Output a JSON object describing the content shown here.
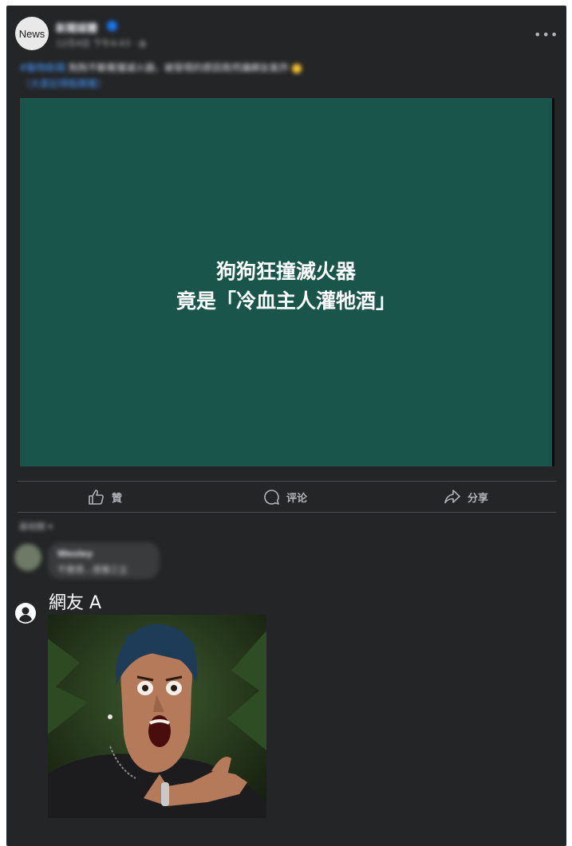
{
  "post": {
    "avatar_text": "News",
    "page_name": "新聞媒體",
    "time": "12月4日 下午4:43 · ",
    "privacy_icon": "globe-icon",
    "more_icon": "more-options-icon",
    "text_tag": "#動物新聞",
    "text_body": " 狗狗不斷衝撞滅火器，被發現的原因竟然讓網友氣炸",
    "link_text": "（大家記得點開看）",
    "media_caption_line1": "狗狗狂撞滅火器",
    "media_caption_line2": "竟是「冷血主人灌牠酒」",
    "colors": {
      "media_bg": "#19554b",
      "panel_bg": "#242526",
      "link": "#4599ff"
    }
  },
  "actions": {
    "like_label": "贊",
    "comment_label": "评论",
    "share_label": "分享"
  },
  "comments": {
    "sort_label": "最相關 ▾",
    "first": {
      "name": "Wesley",
      "text": "不覺得…很像三立"
    }
  },
  "reply": {
    "name": "網友 A",
    "image": "shocked-man-reaction-meme"
  }
}
